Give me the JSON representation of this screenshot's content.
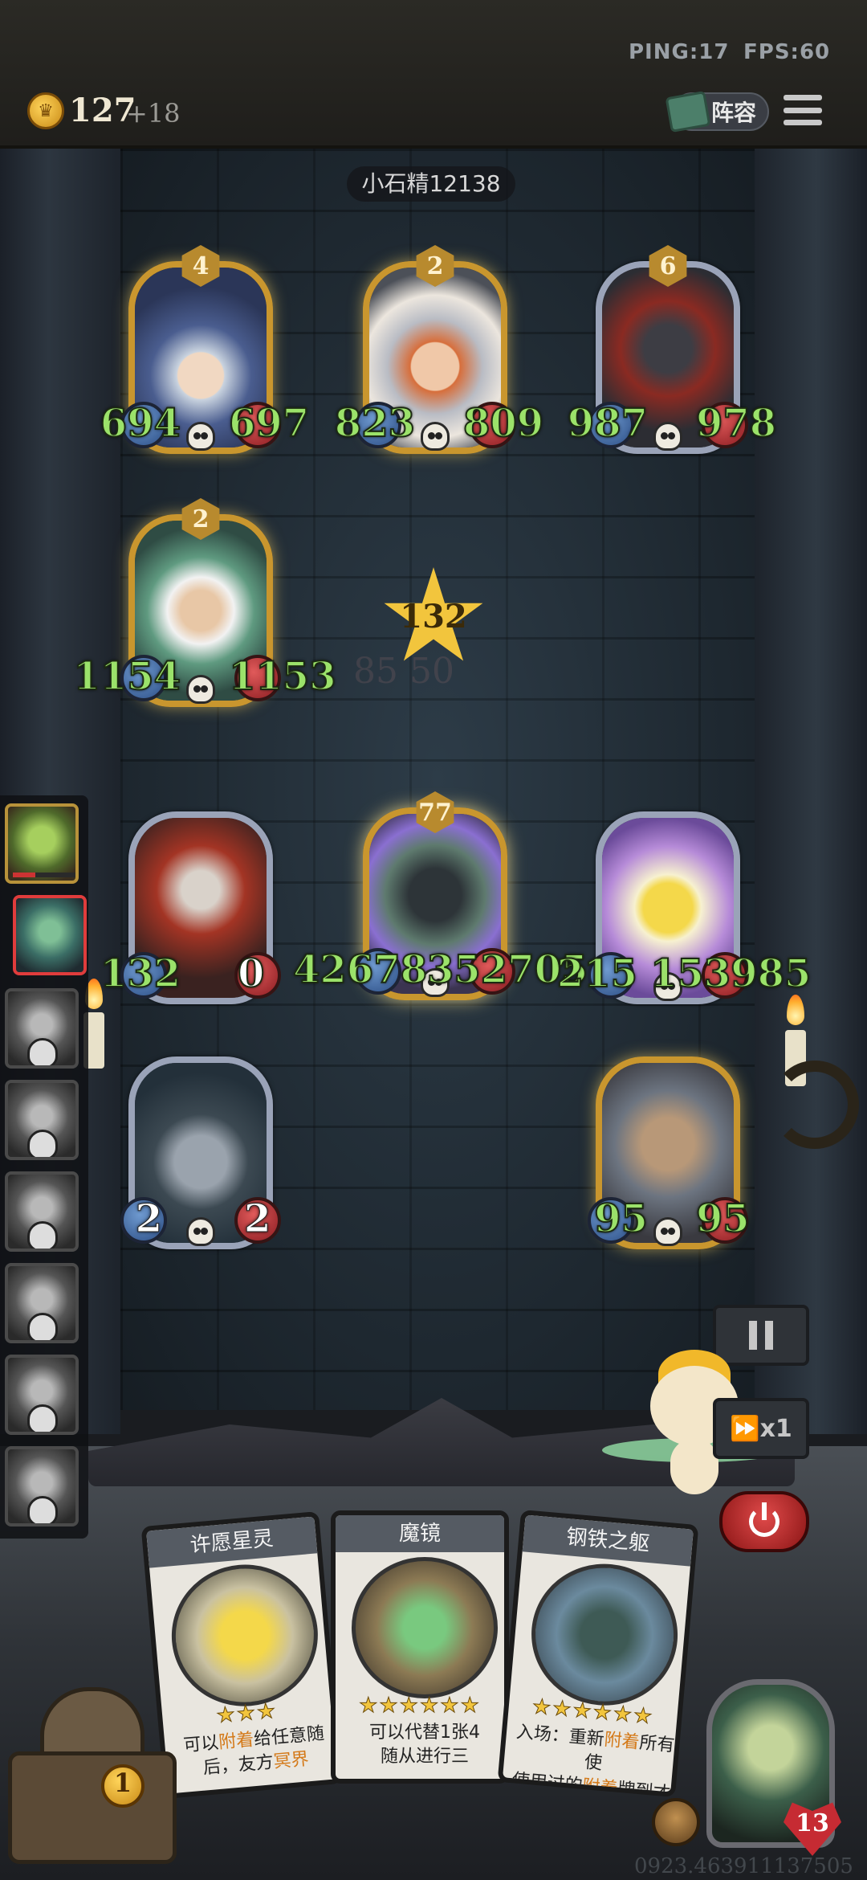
{
  "topbar": {
    "ping": "PING:17",
    "fps": "FPS:60",
    "coins": "127",
    "coin_income": "+18",
    "lineup_label": "阵容"
  },
  "opponent": {
    "name": "小石精12138"
  },
  "enemy_minions": [
    {
      "id": "wizard",
      "tier": "4",
      "attack": "694",
      "health": "697"
    },
    {
      "id": "doctor",
      "tier": "2",
      "attack": "823",
      "health": "809"
    },
    {
      "id": "knight",
      "tier": "6",
      "attack": "987",
      "health": "978"
    },
    {
      "id": "oldman",
      "tier": "2",
      "attack": "1154",
      "health": "1153"
    }
  ],
  "center_star": {
    "value": "132",
    "ghost": "85 50"
  },
  "player_minions": [
    {
      "id": "assassin",
      "attack": "132",
      "health": "0"
    },
    {
      "id": "ironknight",
      "tier": "77",
      "attack": "42678",
      "health": "352705"
    },
    {
      "id": "star",
      "attack": "215",
      "health": "153985"
    },
    {
      "id": "robot",
      "attack": "2",
      "health": "2"
    },
    {
      "id": "airship",
      "attack": "95",
      "health": "95"
    }
  ],
  "controls": {
    "speed_label": "x1"
  },
  "hand_cards": [
    {
      "title": "许愿星灵",
      "stars": "★★★",
      "desc_1": "可以",
      "desc_hl": "附着",
      "desc_2": "给任意随",
      "desc_line2": "后，友方",
      "desc_hl2": "冥界"
    },
    {
      "title": "魔镜",
      "stars": "★★★★★★",
      "desc_1": "可以代替1张4",
      "desc_line2": "随从进行三"
    },
    {
      "title": "钢铁之躯",
      "stars": "★★★★★★",
      "desc_1": "入场：重新",
      "desc_hl": "附着",
      "desc_2": "所有使",
      "desc_line2": "使用过的",
      "desc_hl2": "附着",
      "desc_line2b": "牌到才"
    }
  ],
  "tavern": {
    "level": "1"
  },
  "hero": {
    "health": "13"
  },
  "version": "0923.463911137505",
  "colors": {
    "stat_green": "#9be26a",
    "gold": "#c9962e",
    "danger_red": "#c62b33"
  }
}
